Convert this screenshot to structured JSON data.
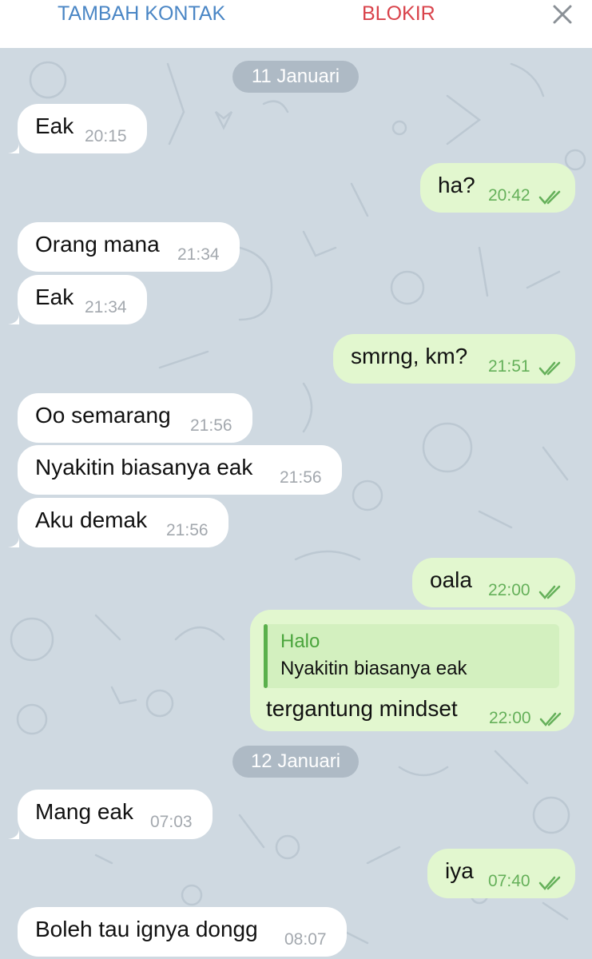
{
  "header": {
    "add_contact": "TAMBAH KONTAK",
    "block": "BLOKIR",
    "close_icon": "close-icon"
  },
  "colors": {
    "add_contact": "#4a86c5",
    "block": "#d9434b",
    "chat_background": "#cfd9e1",
    "incoming_bubble": "#ffffff",
    "outgoing_bubble": "#e2f7cf",
    "outgoing_time": "#65b05a",
    "quote_accent": "#5ab04c"
  },
  "dates": [
    "11 Januari",
    "12 Januari"
  ],
  "messages": [
    {
      "direction": "in",
      "text": "Eak",
      "time": "20:15"
    },
    {
      "direction": "out",
      "text": "ha?",
      "time": "20:42",
      "status": "read"
    },
    {
      "direction": "in",
      "text": "Orang mana",
      "time": "21:34"
    },
    {
      "direction": "in",
      "text": "Eak",
      "time": "21:34"
    },
    {
      "direction": "out",
      "text": "smrng, km?",
      "time": "21:51",
      "status": "read"
    },
    {
      "direction": "in",
      "text": "Oo semarang",
      "time": "21:56"
    },
    {
      "direction": "in",
      "text": "Nyakitin biasanya eak",
      "time": "21:56"
    },
    {
      "direction": "in",
      "text": "Aku demak",
      "time": "21:56"
    },
    {
      "direction": "out",
      "text": "oala",
      "time": "22:00",
      "status": "read"
    },
    {
      "direction": "out",
      "text": "tergantung mindset",
      "time": "22:00",
      "status": "read",
      "quote": {
        "name": "Halo",
        "text": "Nyakitin biasanya eak"
      }
    },
    {
      "direction": "in",
      "text": "Mang eak",
      "time": "07:03"
    },
    {
      "direction": "out",
      "text": "iya",
      "time": "07:40",
      "status": "read"
    },
    {
      "direction": "in",
      "text": "Boleh tau ignya dongg",
      "time": "08:07"
    }
  ]
}
